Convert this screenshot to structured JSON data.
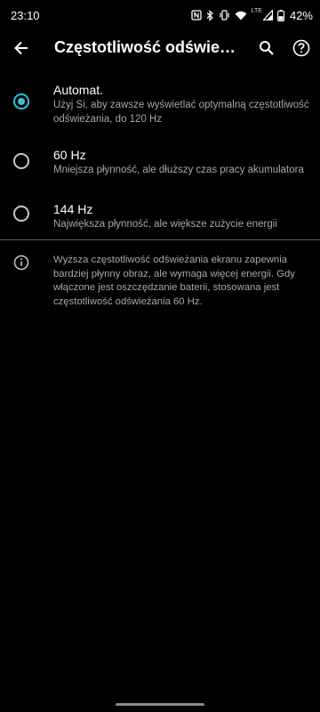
{
  "status_bar": {
    "time": "23:10",
    "network_type": "LTE",
    "battery": "42%",
    "icons": [
      "nfc-icon",
      "bluetooth-icon",
      "vibrate-icon",
      "wifi-icon",
      "signal-icon",
      "battery-icon"
    ]
  },
  "app_bar": {
    "title": "Częstotliwość odświeżania",
    "back_icon": "arrow-back-icon",
    "search_icon": "search-icon",
    "help_icon": "help-icon"
  },
  "options": [
    {
      "title": "Automat.",
      "subtitle": "Użyj Si, aby zawsze wyświetlać optymalną częstotliwość odświeżania, do 120 Hz",
      "selected": true
    },
    {
      "title": "60 Hz",
      "subtitle": "Mniejsza płynność, ale dłuższy czas pracy akumulatora",
      "selected": false
    },
    {
      "title": "144 Hz",
      "subtitle": "Największa płynność, ale większe zużycie energii",
      "selected": false
    }
  ],
  "info": {
    "icon": "info-icon",
    "text": "Wyższa częstotliwość odświeżania ekranu zapewnia bardziej płynny obraz, ale wymaga więcej energii. Gdy włączone jest oszczędzanie baterii, stosowana jest częstotliwość odświeżania 60 Hz."
  },
  "colors": {
    "background": "#000000",
    "accent": "#2bc6d8",
    "primary_text": "#ffffff",
    "secondary_text": "#a8a8a8",
    "divider": "#5a5a5a"
  }
}
